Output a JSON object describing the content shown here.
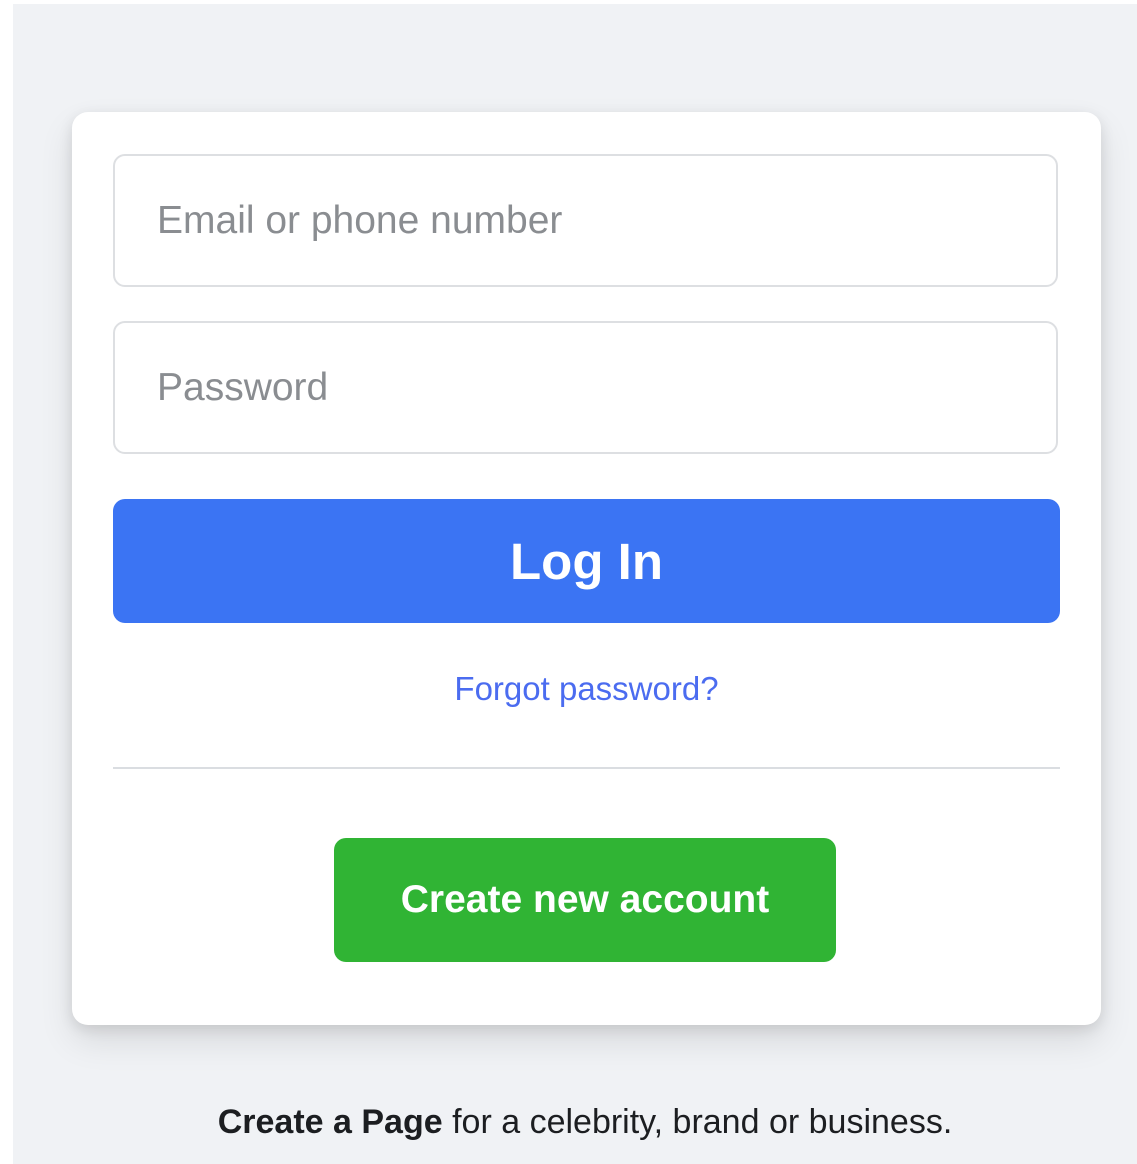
{
  "login": {
    "email_placeholder": "Email or phone number",
    "email_value": "",
    "password_placeholder": "Password",
    "password_value": "",
    "login_label": "Log In",
    "forgot_label": "Forgot password?",
    "create_account_label": "Create new account"
  },
  "footer": {
    "create_page_link": "Create a Page",
    "create_page_rest": " for a celebrity, brand or business."
  },
  "colors": {
    "page_background": "#f0f2f5",
    "primary_blue": "#3b74f3",
    "link_blue": "#4b6cf0",
    "success_green": "#30b434"
  }
}
